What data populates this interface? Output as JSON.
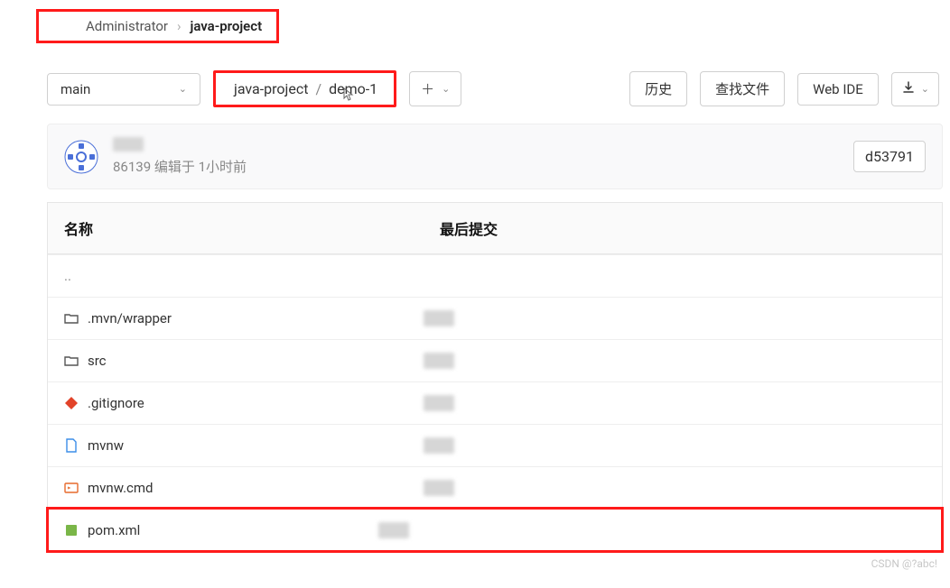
{
  "breadcrumb": {
    "root": "Administrator",
    "current": "java-project"
  },
  "toolbar": {
    "branch": "main",
    "path_parent": "java-project",
    "path_current": "demo-1",
    "history": "历史",
    "find_file": "查找文件",
    "web_ide": "Web IDE"
  },
  "commit": {
    "subline": "86139 编辑于 1小时前",
    "sha": "d53791"
  },
  "headers": {
    "name": "名称",
    "last_commit": "最后提交"
  },
  "rows": {
    "up": "..",
    "mvn": ".mvn/wrapper",
    "src": "src",
    "gitignore": ".gitignore",
    "mvnw": "mvnw",
    "mvnwcmd": "mvnw.cmd",
    "pom": "pom.xml"
  },
  "watermark": "CSDN @?abc!"
}
